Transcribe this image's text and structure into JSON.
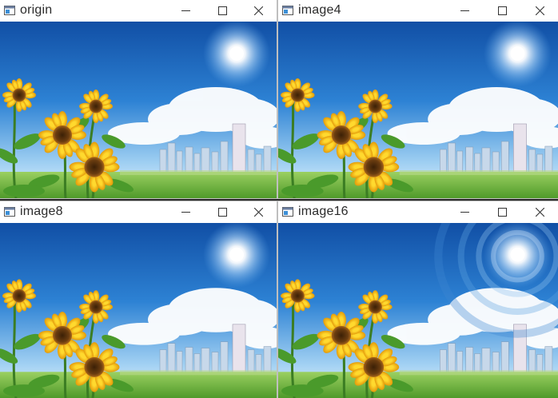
{
  "windows": [
    {
      "title": "origin",
      "posterize": false
    },
    {
      "title": "image4",
      "posterize": false
    },
    {
      "title": "image8",
      "posterize": false
    },
    {
      "title": "image16",
      "posterize": true
    }
  ],
  "controls": {
    "minimize_icon": "minimize-icon",
    "maximize_icon": "maximize-icon",
    "close_icon": "close-icon"
  },
  "scene": {
    "description_icons": [
      "sun-icon",
      "sunflower-icon",
      "city-skyline-icon",
      "cloud-icon"
    ],
    "colors": {
      "sky_top": "#1b63b8",
      "sky_bottom": "#9fd0f0",
      "grass": "#7fc24a",
      "petal": "#f7c21b",
      "center": "#6b3d10"
    }
  }
}
